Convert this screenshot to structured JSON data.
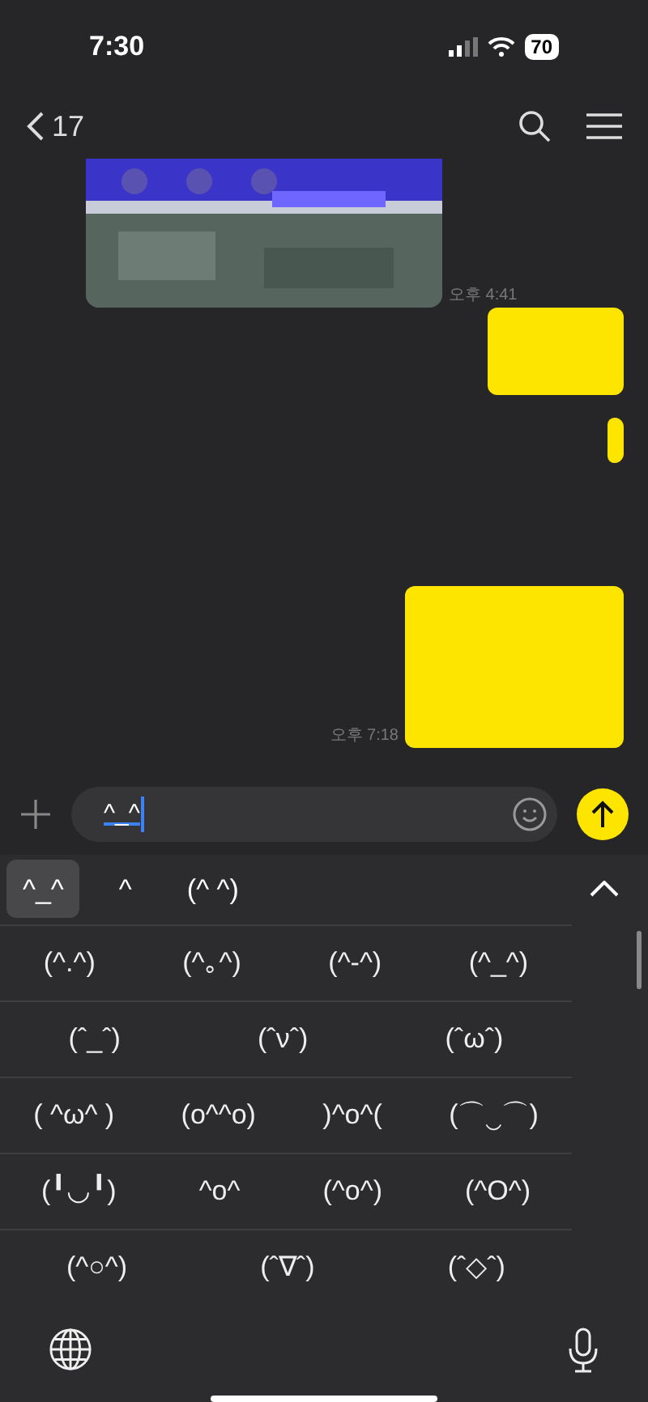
{
  "status_bar": {
    "time": "7:30",
    "battery": "70"
  },
  "header": {
    "back_label": "17"
  },
  "messages": [
    {
      "time": "오후 4:41"
    },
    {
      "kind": "block"
    },
    {
      "kind": "edge"
    },
    {
      "kind": "large",
      "time": "오후 7:18"
    }
  ],
  "composer": {
    "value": "^_^"
  },
  "suggestions": [
    {
      "text": "^_^",
      "selected": true
    },
    {
      "text": "^",
      "selected": false
    },
    {
      "text": "(^ ^)",
      "selected": false
    }
  ],
  "emoticon_rows": [
    [
      "(^.^)",
      "(^｡^)",
      "(^-^)",
      "(^_^)"
    ],
    [
      "(ˆ_ˆ)",
      "(ˆνˆ)",
      "(ˆωˆ)"
    ],
    [
      "( ^ω^ )",
      "(o^^o)",
      ")^o^(",
      "(⌒‿⌒)"
    ],
    [
      "(╹◡╹)",
      "^o^",
      "(^o^)",
      "(^O^)"
    ],
    [
      "(^○^)",
      "(ˆ∇ˆ)",
      "(ˆ◇ˆ)"
    ]
  ]
}
